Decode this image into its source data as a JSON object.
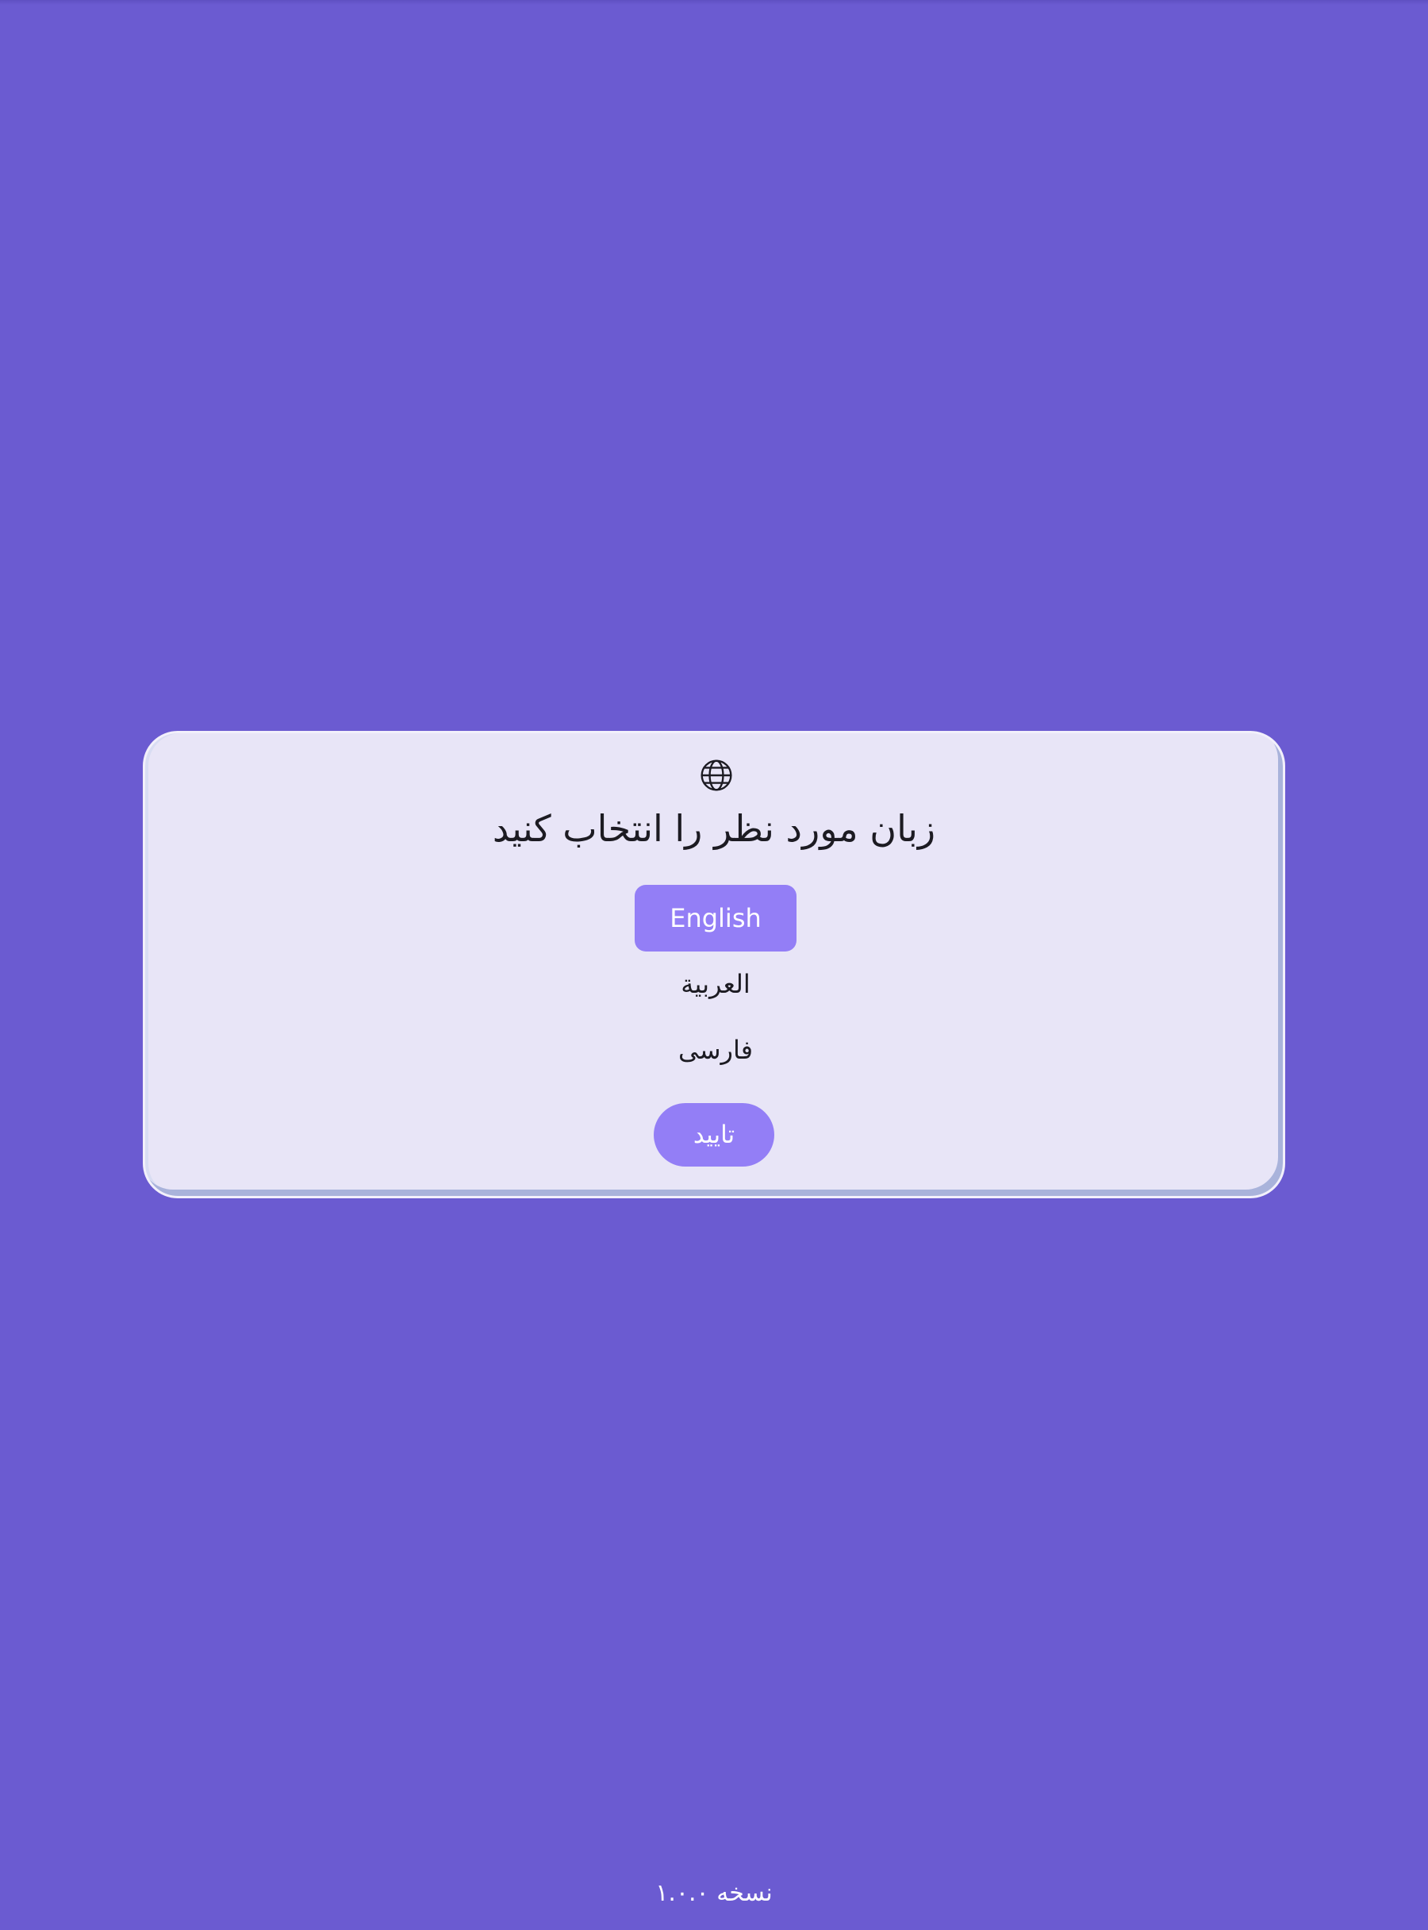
{
  "colors": {
    "background": "#6b5bd1",
    "card": "#e8e5f7",
    "accent": "#937ef6",
    "text": "#1c1b22",
    "on_accent": "#ffffff"
  },
  "language_dialog": {
    "icon": "globe-icon",
    "title": "زبان مورد نظر را انتخاب کنید",
    "options": [
      {
        "label": "English",
        "selected": true
      },
      {
        "label": "العربية",
        "selected": false
      },
      {
        "label": "فارسی",
        "selected": false
      }
    ],
    "confirm_label": "تایید"
  },
  "footer": {
    "version": "نسخه ۱.۰.۰"
  }
}
